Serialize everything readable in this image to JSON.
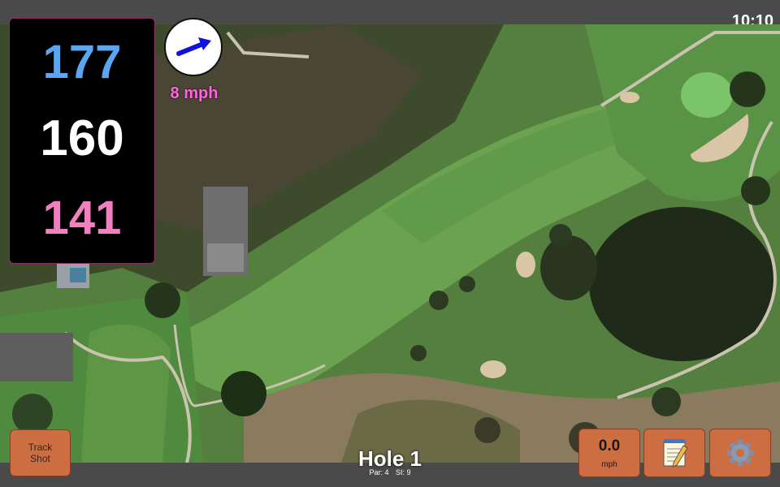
{
  "status": {
    "time": "10:10"
  },
  "distances": {
    "back": "177",
    "middle": "160",
    "front": "141"
  },
  "wind": {
    "speed": "8 mph",
    "direction_icon": "arrow-icon"
  },
  "hole": {
    "title": "Hole 1",
    "par": "Par: 4",
    "stroke_index": "SI: 9"
  },
  "controls": {
    "track_line1": "Track",
    "track_line2": "Shot",
    "shot_speed_value": "0.0",
    "shot_speed_unit": "mph",
    "notes_icon": "notepad-icon",
    "settings_icon": "gear-icon"
  },
  "colors": {
    "accent": "#cd6e42",
    "back": "#5aa6f0",
    "middle": "#ffffff",
    "front": "#f080c0",
    "wind_text": "#ff66e0"
  }
}
